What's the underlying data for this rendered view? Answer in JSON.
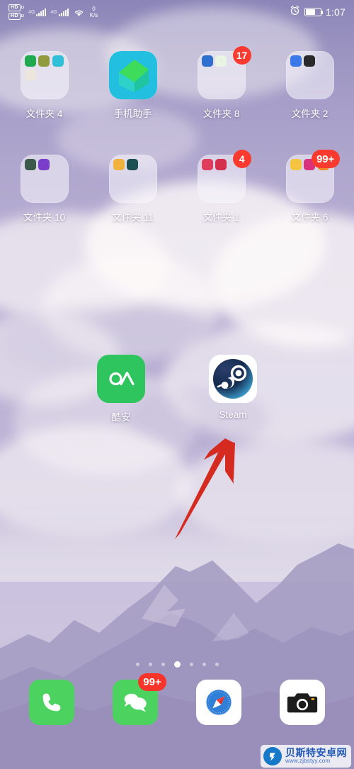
{
  "status_bar": {
    "volte_badges": [
      "HD",
      "HD"
    ],
    "volte_sub": "D",
    "network_gen_1": "4G",
    "network_gen_2": "4G",
    "data_speed_value": "0",
    "data_speed_unit": "K/s",
    "alarm_icon": "alarm-clock-icon",
    "battery_level_percent": 60,
    "time": "1:07"
  },
  "home_screen": {
    "rows": [
      {
        "items": [
          {
            "label": "文件夹 4",
            "type": "folder",
            "badge": "",
            "mini_colors": [
              "#1faa4f",
              "#8f9b3c",
              "#2fc0d8",
              "#e8e2d8"
            ]
          },
          {
            "label": "手机助手",
            "type": "app",
            "icon": "phone-assistant-icon",
            "badge": ""
          },
          {
            "label": "文件夹 8",
            "type": "folder",
            "badge": "17",
            "mini_colors": [
              "#2f6fd0",
              "#e8f2e0"
            ]
          },
          {
            "label": "文件夹 2",
            "type": "folder",
            "badge": "",
            "mini_colors": [
              "#3b79e8",
              "#2a2a2a"
            ]
          }
        ]
      },
      {
        "items": [
          {
            "label": "文件夹 10",
            "type": "folder",
            "badge": "",
            "mini_colors": [
              "#3c5a4a",
              "#7a3fc9"
            ]
          },
          {
            "label": "文件夹 11",
            "type": "folder",
            "badge": "",
            "mini_colors": [
              "#f0b23c",
              "#1b4f52"
            ]
          },
          {
            "label": "文件夹 1",
            "type": "folder",
            "badge": "4",
            "mini_colors": [
              "#e03c5c",
              "#d4304e"
            ]
          },
          {
            "label": "文件夹 6",
            "type": "folder",
            "badge": "99+",
            "mini_colors": [
              "#f5c542",
              "#d9317e",
              "#f08a1e"
            ]
          }
        ]
      }
    ],
    "featured_apps": [
      {
        "label": "酷安",
        "icon": "coolapk-icon",
        "bg": "#2ec45e"
      },
      {
        "label": "Steam",
        "icon": "steam-icon",
        "bg": "#ffffff"
      }
    ],
    "page_indicator": {
      "total": 7,
      "active_index": 3
    }
  },
  "dock": {
    "items": [
      {
        "name": "phone",
        "icon": "phone-handset-icon",
        "badge": ""
      },
      {
        "name": "messages",
        "icon": "speech-bubbles-icon",
        "badge": "99+"
      },
      {
        "name": "safari",
        "icon": "compass-icon",
        "badge": ""
      },
      {
        "name": "camera",
        "icon": "camera-icon",
        "badge": ""
      }
    ]
  },
  "annotation": {
    "arrow": {
      "color": "#d42a20",
      "points_to": "Steam",
      "from": [
        245,
        757
      ],
      "to": [
        322,
        622
      ]
    }
  },
  "watermark": {
    "title": "贝斯特安卓网",
    "url": "www.zjbstyy.com"
  }
}
